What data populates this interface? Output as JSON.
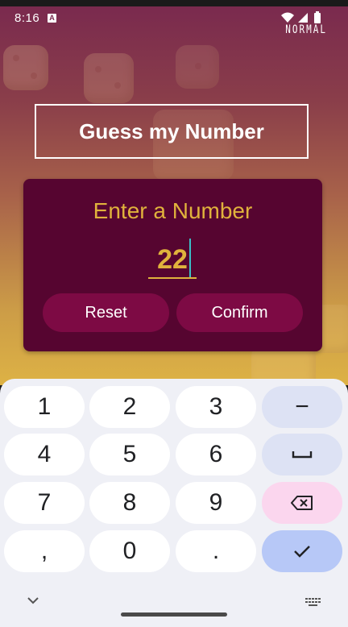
{
  "status_bar": {
    "time": "8:16",
    "notification_icon": "a-letter-icon",
    "icons": [
      "wifi-icon",
      "signal-icon",
      "battery-icon"
    ],
    "mode_label": "NORMAL"
  },
  "app": {
    "title": "Guess my Number",
    "input_label": "Enter a Number",
    "input_value": "22",
    "reset_label": "Reset",
    "confirm_label": "Confirm"
  },
  "keyboard": {
    "rows": [
      [
        "1",
        "2",
        "3",
        "−"
      ],
      [
        "4",
        "5",
        "6",
        "␣"
      ],
      [
        "7",
        "8",
        "9",
        "⌫"
      ],
      [
        ",",
        "0",
        ".",
        "✓"
      ]
    ],
    "icons": {
      "space": "space-icon",
      "backspace": "backspace-icon",
      "done": "done-check-icon",
      "hide": "chevron-down-icon",
      "switch": "keyboard-icon"
    }
  },
  "colors": {
    "card": "#560530",
    "button": "#7d0a44",
    "accent": "#e0b23c",
    "caret": "#3ac0c8"
  }
}
